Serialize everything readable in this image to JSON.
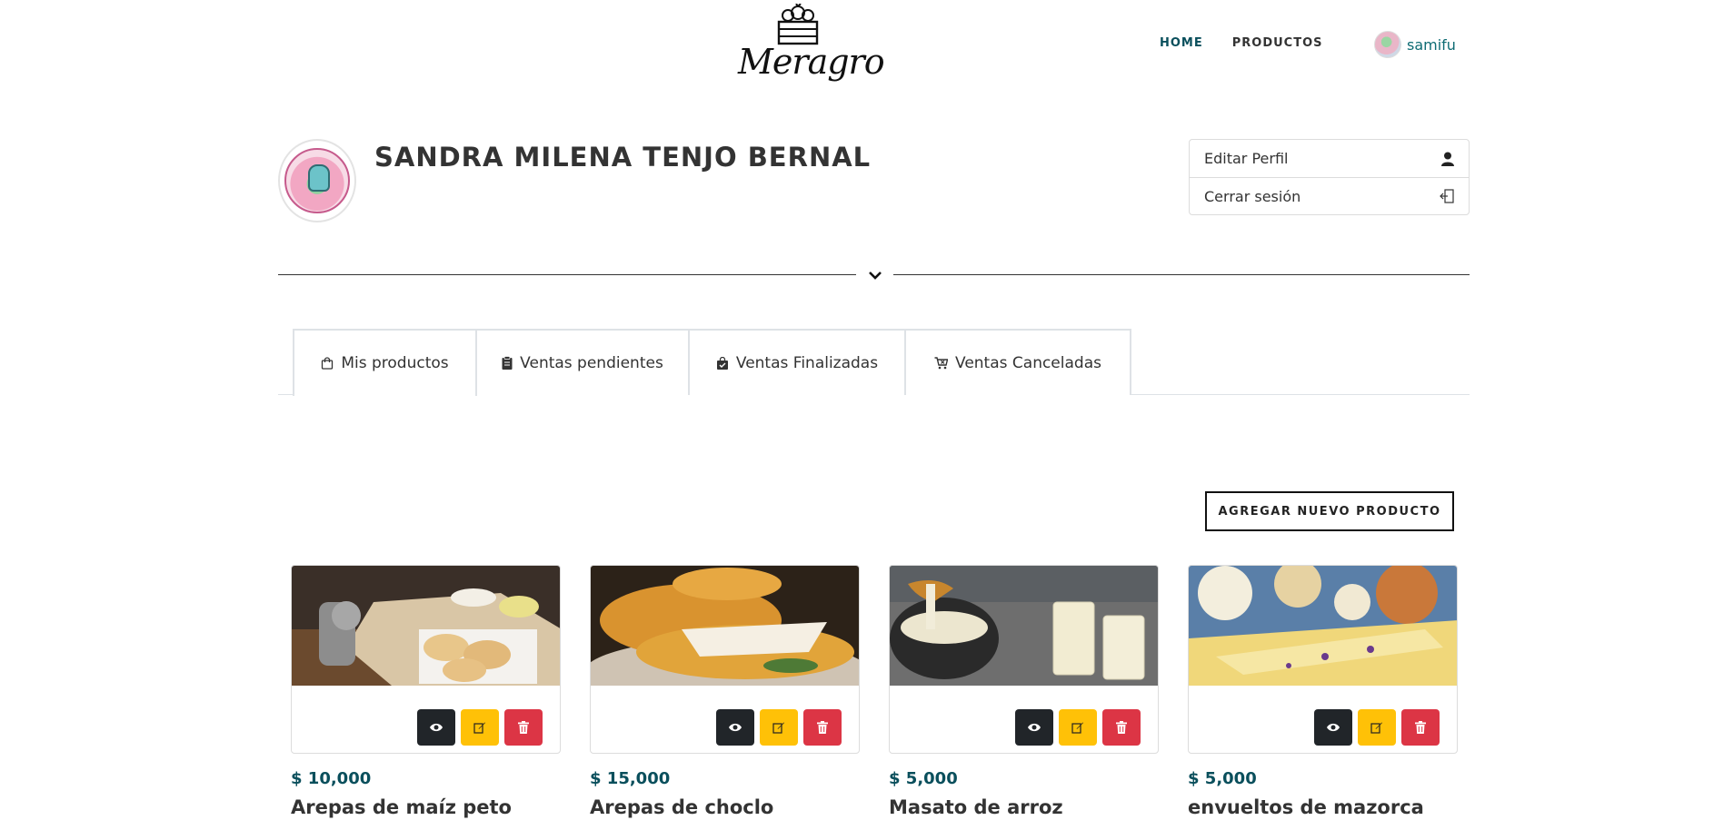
{
  "brand": {
    "name": "Meragro"
  },
  "nav": {
    "items": [
      {
        "label": "HOME",
        "active": true
      },
      {
        "label": "PRODUCTOS",
        "active": false
      }
    ]
  },
  "user": {
    "name": "samifu"
  },
  "profile": {
    "name": "SANDRA MILENA TENJO BERNAL"
  },
  "side_menu": {
    "edit_label": "Editar Perfil",
    "edit_icon": "user-icon",
    "logout_label": "Cerrar sesión",
    "logout_icon": "logout-icon"
  },
  "tabs": [
    {
      "label": "Mis productos",
      "icon": "shopping-bag-icon",
      "active": true
    },
    {
      "label": "Ventas pendientes",
      "icon": "clipboard-icon",
      "active": false
    },
    {
      "label": "Ventas Finalizadas",
      "icon": "bag-check-icon",
      "active": false
    },
    {
      "label": "Ventas Canceladas",
      "icon": "cart-x-icon",
      "active": false
    }
  ],
  "add_button": {
    "label": "AGREGAR NUEVO PRODUCTO"
  },
  "products": [
    {
      "price": "$ 10,000",
      "name": "Arepas de maíz peto"
    },
    {
      "price": "$ 15,000",
      "name": "Arepas de choclo"
    },
    {
      "price": "$ 5,000",
      "name": "Masato de arroz"
    },
    {
      "price": "$ 5,000",
      "name": "envueltos de mazorca"
    }
  ],
  "colors": {
    "accent": "#0a4f5c",
    "view": "#212529",
    "edit": "#ffc107",
    "delete": "#dc3545"
  }
}
